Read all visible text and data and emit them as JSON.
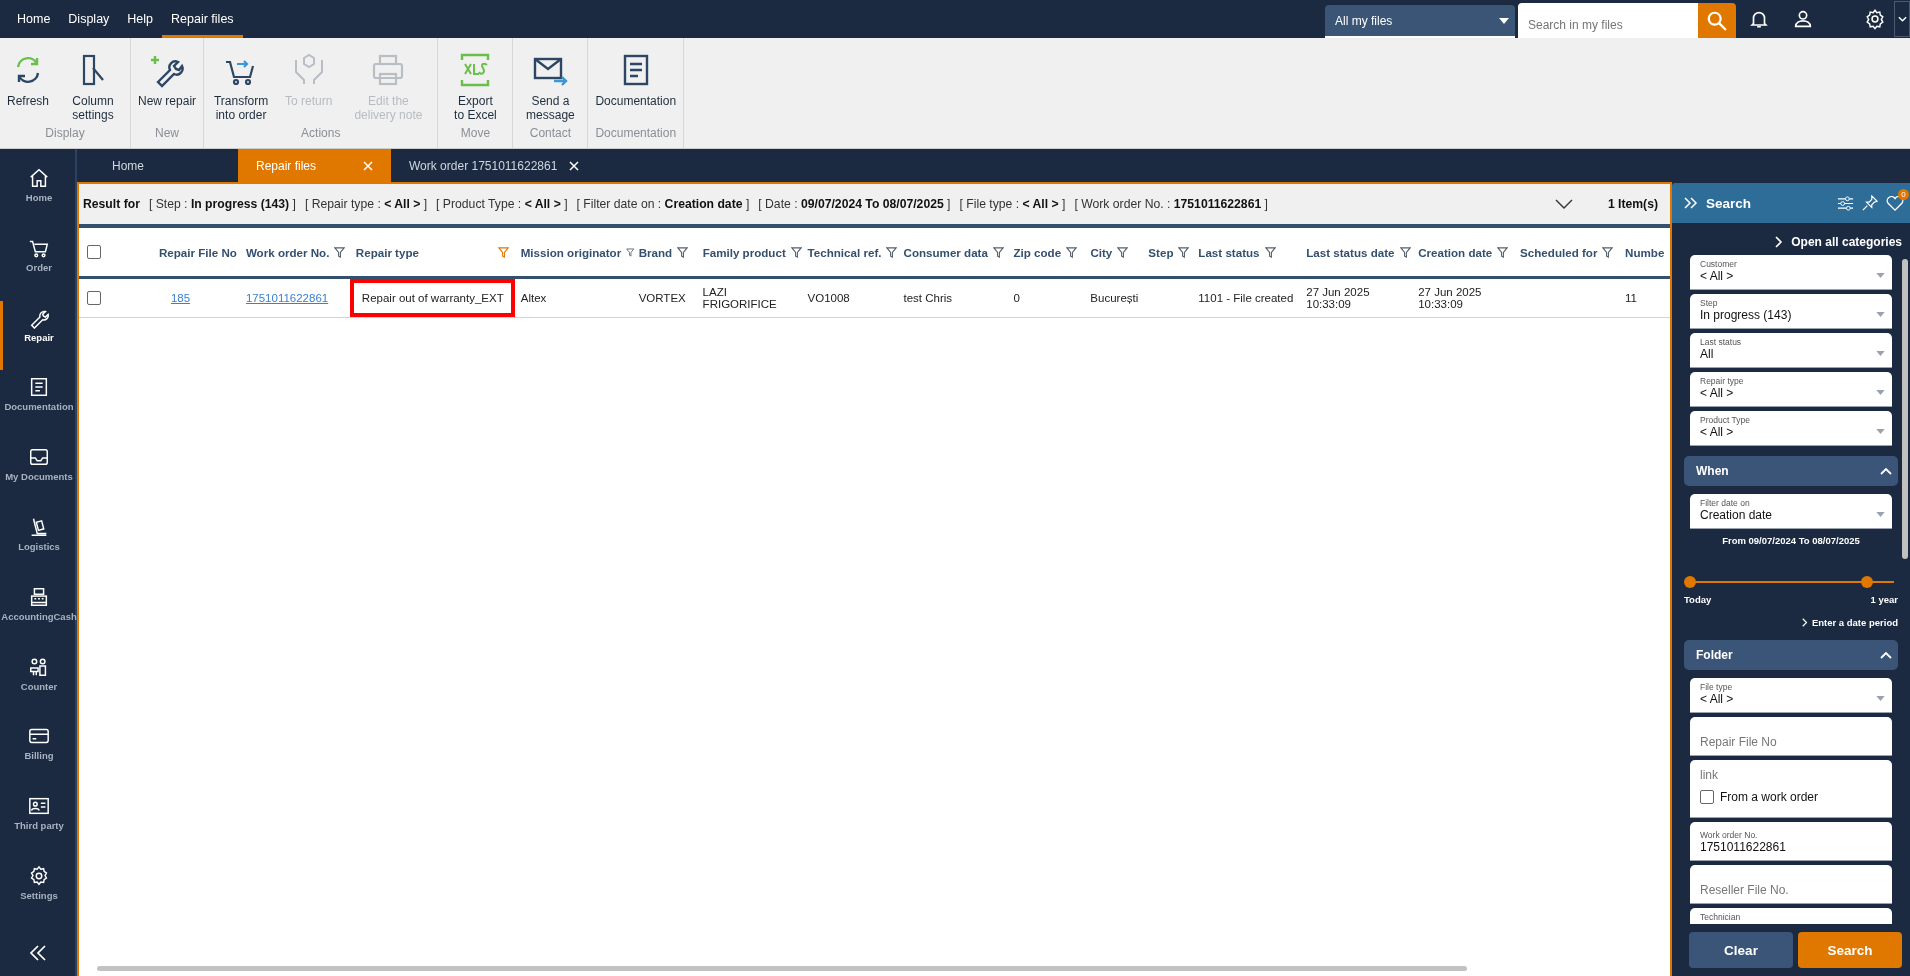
{
  "top_menu": [
    {
      "label": "Home",
      "selected": false
    },
    {
      "label": "Display",
      "selected": false
    },
    {
      "label": "Help",
      "selected": false
    },
    {
      "label": "Repair files",
      "selected": true
    }
  ],
  "scope_select": {
    "value": "All my files"
  },
  "global_search": {
    "placeholder": "Search in my files"
  },
  "ribbon": [
    {
      "group": "Display",
      "buttons": [
        {
          "label": "Refresh",
          "kind": "refresh",
          "disabled": false
        },
        {
          "label": "Column settings",
          "kind": "columns",
          "disabled": false
        }
      ]
    },
    {
      "group": "New",
      "buttons": [
        {
          "label": "New repair",
          "kind": "new-repair",
          "disabled": false
        }
      ]
    },
    {
      "group": "Actions",
      "buttons": [
        {
          "label": "Transform into order",
          "kind": "cart",
          "disabled": false
        },
        {
          "label": "To return",
          "kind": "return",
          "disabled": true
        },
        {
          "label": "Edit the delivery note",
          "kind": "print",
          "disabled": true
        }
      ]
    },
    {
      "group": "Move",
      "buttons": [
        {
          "label": "Export to Excel",
          "kind": "xls",
          "disabled": false
        }
      ]
    },
    {
      "group": "Contact",
      "buttons": [
        {
          "label": "Send a message",
          "kind": "mail",
          "disabled": false
        }
      ]
    },
    {
      "group": "Documentation",
      "buttons": [
        {
          "label": "Documentation",
          "kind": "doc",
          "disabled": false
        }
      ]
    }
  ],
  "sidebar": {
    "items": [
      {
        "label": "Home",
        "kind": "home",
        "selected": false
      },
      {
        "label": "Order",
        "kind": "cart",
        "selected": false
      },
      {
        "label": "Repair",
        "kind": "wrench",
        "selected": true
      },
      {
        "label": "Documentation",
        "kind": "doc",
        "selected": false
      },
      {
        "label": "My Documents",
        "kind": "inbox",
        "selected": false
      },
      {
        "label": "Logistics",
        "kind": "dolly",
        "selected": false
      },
      {
        "label": "AccountingCash",
        "kind": "register",
        "selected": false
      },
      {
        "label": "Counter",
        "kind": "people",
        "selected": false
      },
      {
        "label": "Billing",
        "kind": "card",
        "selected": false
      },
      {
        "label": "Third party",
        "kind": "idcard",
        "selected": false
      },
      {
        "label": "Settings",
        "kind": "gear",
        "selected": false
      }
    ]
  },
  "tabs": [
    {
      "label": "Home",
      "selected": false,
      "closable": false
    },
    {
      "label": "Repair files",
      "selected": true,
      "closable": true
    },
    {
      "label": "Work order 1751011622861",
      "selected": false,
      "closable": true
    }
  ],
  "filter_summary": {
    "title": "Result for",
    "criteria": [
      "[ Step : **In progress (143)** ]",
      "[ Repair type : **< All >** ]",
      "[ Product Type : **< All >** ]",
      "[ Filter date on : **Creation date** ]",
      "[ Date : **09/07/2024 To 08/07/2025** ]",
      "[ File type : **< All >** ]",
      "[ Work order No. : **1751011622861** ]"
    ],
    "count": "1 Item(s)"
  },
  "table": {
    "select_all_checked": false,
    "columns": [
      {
        "label": "Repair File No",
        "highlighted": false
      },
      {
        "label": "Work order No.",
        "filtered": false,
        "highlighted": false
      },
      {
        "label": "Repair type",
        "filtered": true,
        "highlighted": true
      },
      {
        "label": "Mission originator",
        "filtered": false,
        "highlighted": false
      },
      {
        "label": "Brand",
        "filtered": false,
        "highlighted": false
      },
      {
        "label": "Family product",
        "filtered": false,
        "highlighted": false
      },
      {
        "label": "Technical ref.",
        "filtered": false,
        "highlighted": false
      },
      {
        "label": "Consumer data",
        "filtered": false,
        "highlighted": false
      },
      {
        "label": "Zip code",
        "filtered": false,
        "highlighted": false
      },
      {
        "label": "City",
        "filtered": false,
        "highlighted": false
      },
      {
        "label": "Step",
        "filtered": false,
        "highlighted": false
      },
      {
        "label": "Last status",
        "filtered": false,
        "highlighted": false
      },
      {
        "label": "Last status date",
        "filtered": false,
        "highlighted": false
      },
      {
        "label": "Creation date",
        "filtered": false,
        "highlighted": false
      },
      {
        "label": "Scheduled for",
        "filtered": false,
        "highlighted": false
      },
      {
        "label": "Numbe",
        "highlighted": false
      }
    ],
    "rows": [
      {
        "checked": false,
        "cells": [
          {
            "kind": "link",
            "text": "185"
          },
          {
            "kind": "link",
            "text": "1751011622861"
          },
          {
            "kind": "text",
            "text": "Repair out of warranty_EXT"
          },
          {
            "kind": "text",
            "text": "Altex"
          },
          {
            "kind": "text",
            "text": "VORTEX"
          },
          {
            "kind": "text",
            "text": "LAZI FRIGORIFICE"
          },
          {
            "kind": "text",
            "text": "VO1008"
          },
          {
            "kind": "text",
            "text": "test Chris"
          },
          {
            "kind": "text",
            "text": "0"
          },
          {
            "kind": "text",
            "text": "București"
          },
          null,
          {
            "kind": "text",
            "text": "1101 - File created"
          },
          {
            "kind": "text",
            "text": "27 Jun 2025 10:33:09"
          },
          {
            "kind": "text",
            "text": "27 Jun 2025 10:33:09"
          },
          null,
          {
            "kind": "text",
            "text": "11"
          }
        ]
      }
    ]
  },
  "search_panel": {
    "title": "Search",
    "favorites_count": "0",
    "open_all": "Open all categories",
    "items": [
      {
        "kind": "select",
        "label": "Customer",
        "value": "< All >"
      },
      {
        "kind": "select",
        "label": "Step",
        "value": "In progress (143)"
      },
      {
        "kind": "select",
        "label": "Last status",
        "value": "All"
      },
      {
        "kind": "select",
        "label": "Repair type",
        "value": "< All >"
      },
      {
        "kind": "select",
        "label": "Product Type",
        "value": "< All >"
      },
      {
        "kind": "section",
        "label": "When",
        "expanded": true
      },
      {
        "kind": "select",
        "label": "Filter date on",
        "value": "Creation date"
      },
      {
        "kind": "note",
        "text": "From 09/07/2024 To 08/07/2025"
      },
      {
        "kind": "slider",
        "labels": [
          "Today",
          "1 year"
        ],
        "level": 0.9
      },
      {
        "kind": "link",
        "text": "Enter a date period"
      },
      {
        "kind": "section",
        "label": "Folder",
        "expanded": true
      },
      {
        "kind": "select",
        "label": "File type",
        "value": "< All >"
      },
      {
        "kind": "input",
        "placeholder": "Repair File No"
      },
      {
        "kind": "check",
        "placeholder": "link",
        "label": "From a work order",
        "checked": false
      },
      {
        "kind": "input",
        "label": "Work order No.",
        "value": "1751011622861"
      },
      {
        "kind": "input",
        "placeholder": "Reseller File No."
      },
      {
        "kind": "select",
        "label": "Technician"
      }
    ],
    "buttons": [
      {
        "label": "Clear",
        "kind": "secondary"
      },
      {
        "label": "Search",
        "kind": "primary"
      }
    ]
  }
}
